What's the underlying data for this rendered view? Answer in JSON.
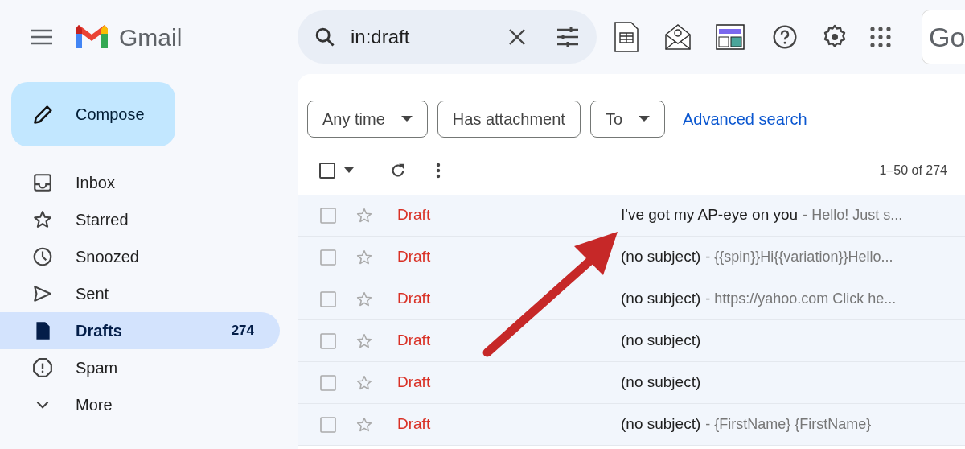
{
  "header": {
    "app_name": "Gmail",
    "search": {
      "value": "in:draft"
    },
    "account_label": "Go"
  },
  "compose": {
    "label": "Compose"
  },
  "sidebar": {
    "items": [
      {
        "kind": "inbox",
        "label": "Inbox",
        "selected": false
      },
      {
        "kind": "star",
        "label": "Starred",
        "selected": false
      },
      {
        "kind": "clock",
        "label": "Snoozed",
        "selected": false
      },
      {
        "kind": "send",
        "label": "Sent",
        "selected": false
      },
      {
        "kind": "draft",
        "label": "Drafts",
        "count": "274",
        "selected": true
      },
      {
        "kind": "spam",
        "label": "Spam",
        "selected": false
      },
      {
        "kind": "more",
        "label": "More",
        "selected": false
      }
    ]
  },
  "filters": [
    {
      "label": "Any time",
      "dropdown": true
    },
    {
      "label": "Has attachment",
      "dropdown": false
    },
    {
      "label": "To",
      "dropdown": true
    }
  ],
  "advanced_search": "Advanced search",
  "pagination": "1–50 of 274",
  "rows": [
    {
      "label": "Draft",
      "subject": "I've got my AP-eye on you",
      "snippet": "- Hello! Just s..."
    },
    {
      "label": "Draft",
      "subject": "(no subject)",
      "snippet": "- {{spin}}Hi{{variation}}Hello..."
    },
    {
      "label": "Draft",
      "subject": "(no subject)",
      "snippet": "- https://yahoo.com Click he..."
    },
    {
      "label": "Draft",
      "subject": "(no subject)"
    },
    {
      "label": "Draft",
      "subject": "(no subject)"
    },
    {
      "label": "Draft",
      "subject": "(no subject)",
      "snippet": "- {FirstName} {FirstName}"
    }
  ]
}
